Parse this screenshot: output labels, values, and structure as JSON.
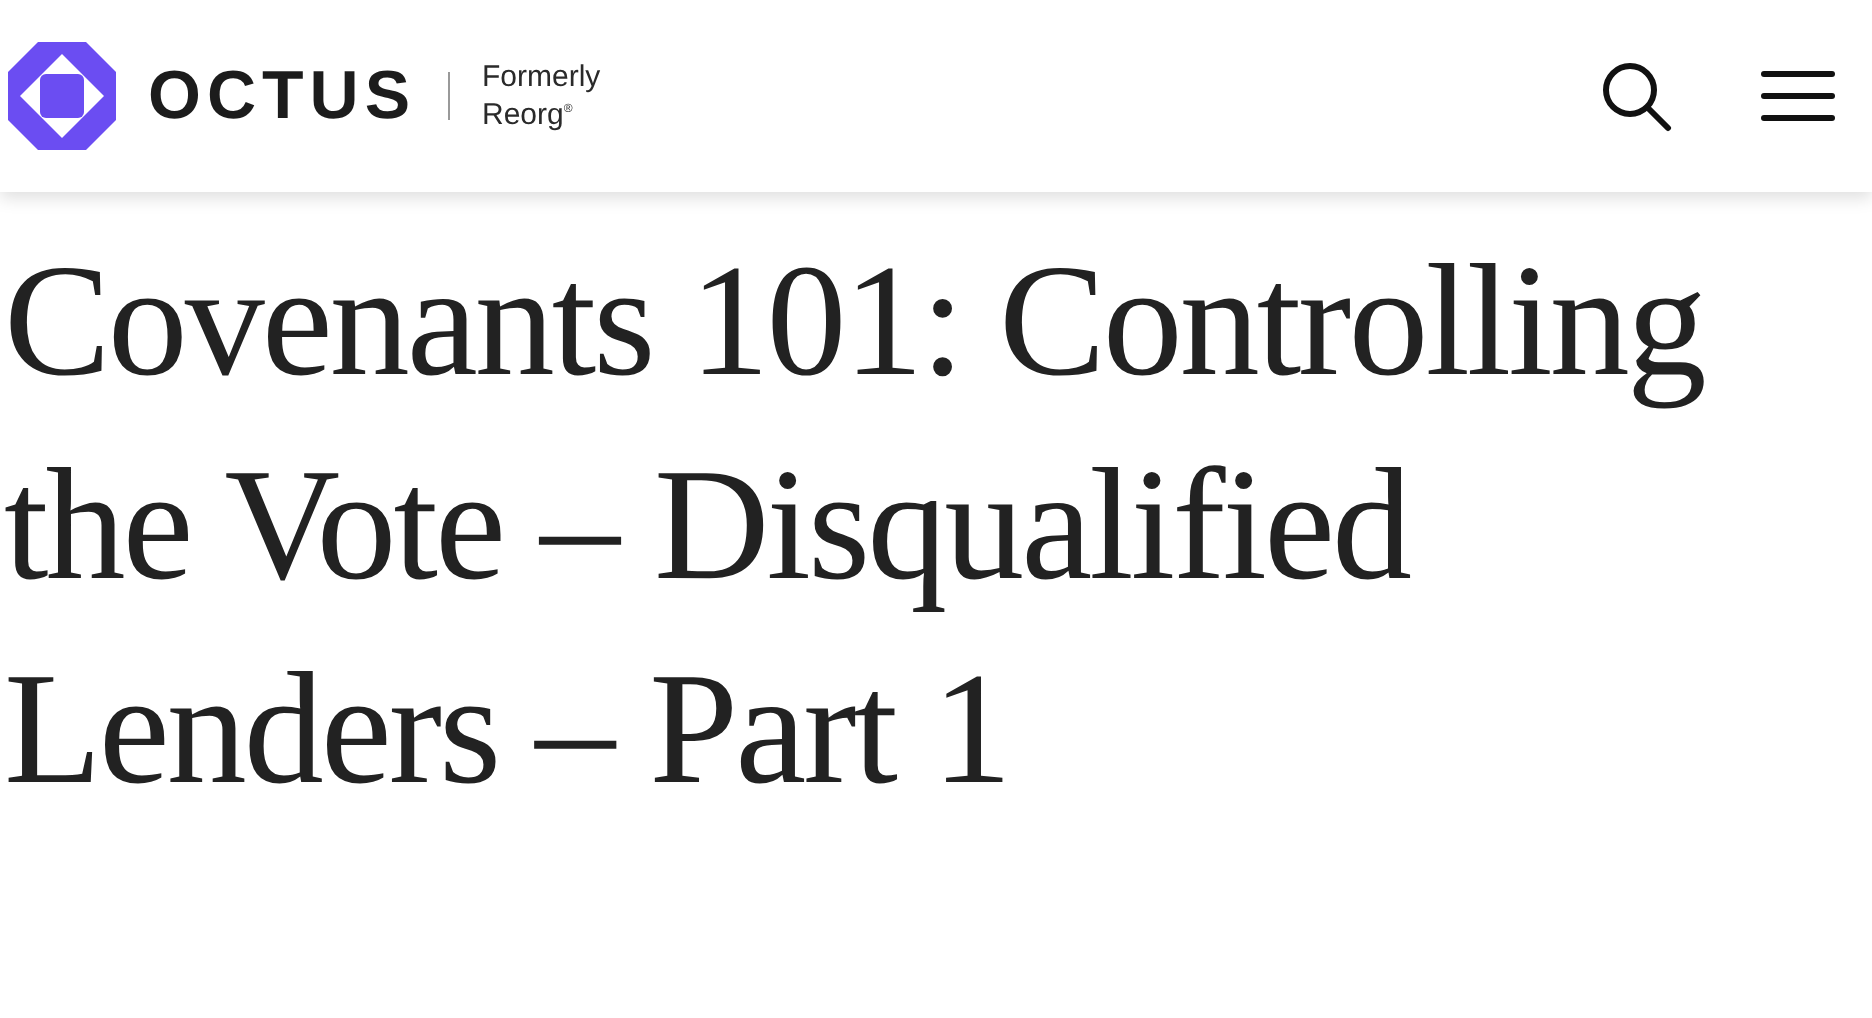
{
  "header": {
    "brand": "OCTUS",
    "tagline_line_1": "Formerly",
    "tagline_line_2": "Reorg$^{®}$"
  },
  "article": {
    "title": "Covenants 101: Controlling the Vote – Disqualified Lenders – Part 1"
  }
}
